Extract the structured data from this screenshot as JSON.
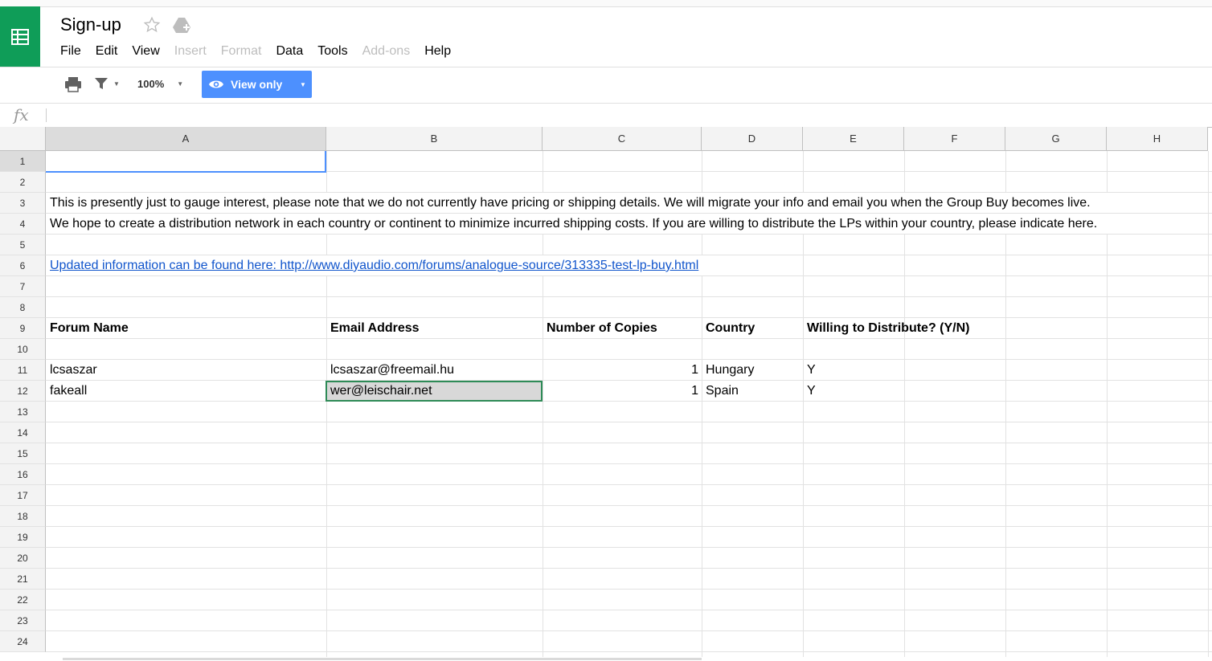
{
  "app": {
    "doc_title": "Sign-up",
    "logo_icon": "sheets-logo-icon",
    "accent": "#0f9d58"
  },
  "menu": [
    "File",
    "Edit",
    "View",
    "Insert",
    "Format",
    "Data",
    "Tools",
    "Add-ons",
    "Help"
  ],
  "menu_disabled": [
    "Insert",
    "Format",
    "Add-ons"
  ],
  "toolbar": {
    "zoom": "100%",
    "view_only": "View only",
    "view_only_color": "#4d90fe"
  },
  "formula_bar": {
    "fx": "fx",
    "value": ""
  },
  "columns": [
    "A",
    "B",
    "C",
    "D",
    "E",
    "F",
    "G",
    "H"
  ],
  "rows": [
    "1",
    "2",
    "3",
    "4",
    "5",
    "6",
    "7",
    "8",
    "9",
    "10",
    "11",
    "12",
    "13",
    "14",
    "15",
    "16",
    "17",
    "18",
    "19",
    "20",
    "21",
    "22",
    "23",
    "24"
  ],
  "cells": {
    "r3": "This is presently just to gauge interest, please note that we do not currently have pricing or shipping details. We will migrate your info and email you when the Group Buy becomes live.",
    "r4": "We hope to create a distribution network in each country or continent to minimize incurred shipping costs. If you are willing to distribute the LPs within your country, please indicate here.",
    "r6": "Updated information can be found here: http://www.diyaudio.com/forums/analogue-source/313335-test-lp-buy.html",
    "headers": [
      "Forum Name",
      "Email Address",
      "Number of Copies",
      "Country",
      "Willing to Distribute? (Y/N)"
    ],
    "data_rows": [
      [
        "lcsaszar",
        "lcsaszar@freemail.hu",
        "1",
        "Hungary",
        "Y"
      ],
      [
        "fakeall",
        "wer@leischair.net",
        "1",
        "Spain",
        "Y"
      ]
    ]
  },
  "selection": {
    "active_cell": "A1",
    "highlighted_cell": "B12"
  }
}
